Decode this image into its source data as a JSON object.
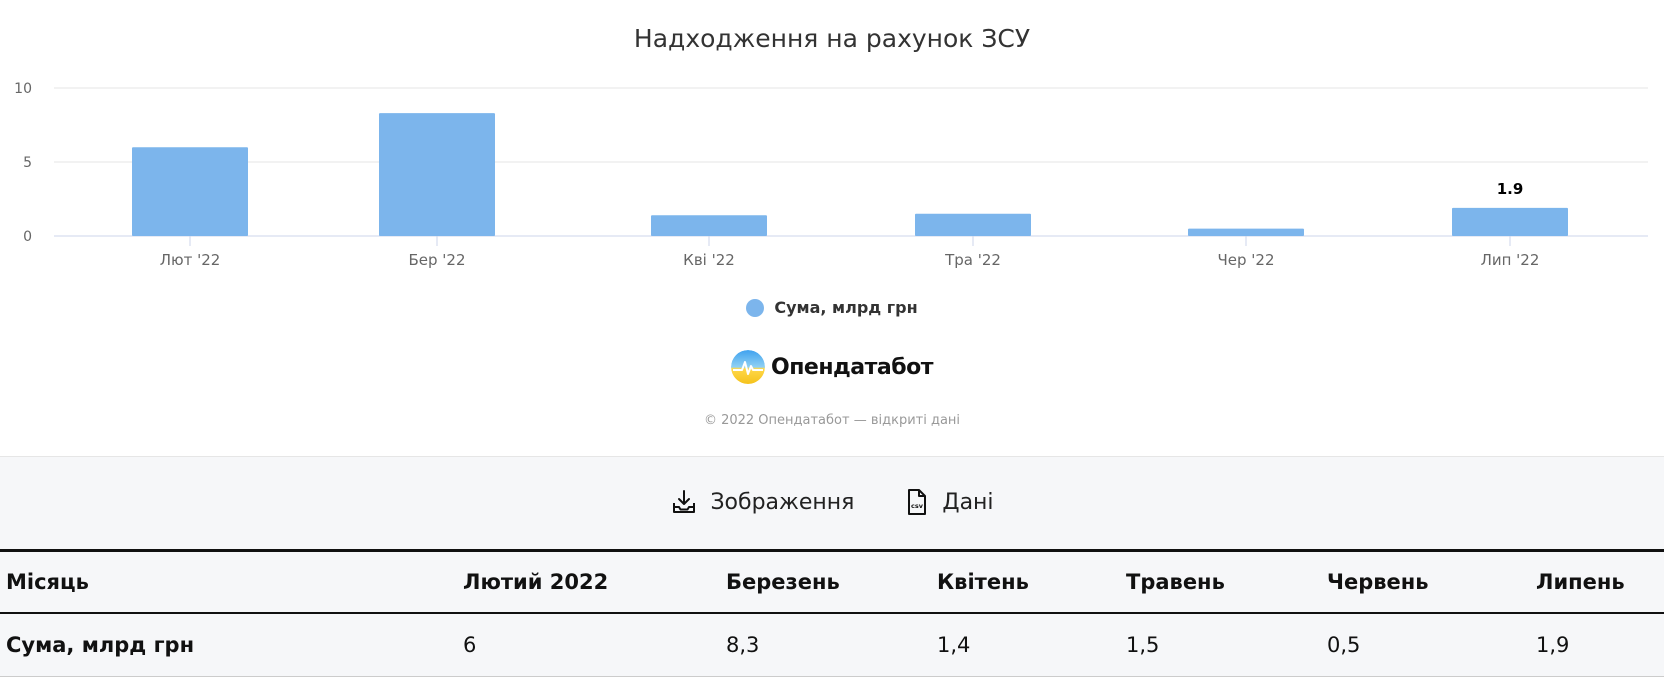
{
  "chart_data": {
    "type": "bar",
    "title": "Надходження на рахунок ЗСУ",
    "categories": [
      "Лют '22",
      "Бер '22",
      "Кві '22",
      "Тра '22",
      "Чер '22",
      "Лип '22"
    ],
    "series": [
      {
        "name": "Сума, млрд грн",
        "values": [
          6,
          8.3,
          1.4,
          1.5,
          0.5,
          1.9
        ],
        "color": "#7cb5ec"
      }
    ],
    "data_labels": [
      null,
      null,
      null,
      null,
      null,
      "1.9"
    ],
    "yticks": [
      "0",
      "5",
      "10"
    ],
    "ylim": [
      0,
      10
    ],
    "xlabel": "",
    "ylabel": "",
    "grid": true,
    "legend": "bottom-center"
  },
  "brand": {
    "name": "Опендатабот",
    "logo_icon": "opendatabot-logo-icon"
  },
  "copyright": "© 2022 Опендатабот — відкриті дані",
  "toolbar": {
    "image_label": "Зображення",
    "image_icon": "download-icon",
    "data_label": "Дані",
    "data_icon": "csv-file-icon"
  },
  "table": {
    "headers": [
      "Місяць",
      "Лютий 2022",
      "Березень",
      "Квітень",
      "Травень",
      "Червень",
      "Липень"
    ],
    "rows": [
      [
        "Сума, млрд грн",
        "6",
        "8,3",
        "1,4",
        "1,5",
        "0,5",
        "1,9"
      ]
    ]
  },
  "colors": {
    "bar": "#7cb5ec",
    "grid": "#e6e6e6",
    "axis": "#ccd6eb"
  }
}
